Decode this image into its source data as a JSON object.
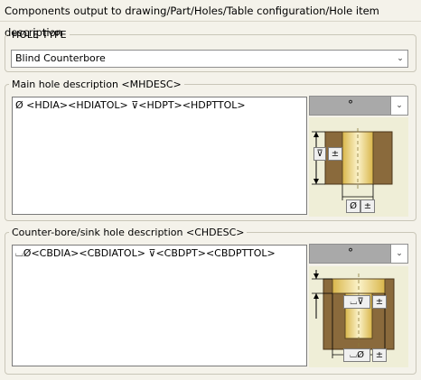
{
  "title": "Components output to drawing/Part/Holes/Table configuration/Hole item description",
  "hole_type": {
    "legend": "HOLE TYPE",
    "selected": "Blind Counterbore"
  },
  "main_hole": {
    "legend": "Main hole description <MHDESC>",
    "text": "Ø <HDIA><HDIATOL> ⊽<HDPT><HDPTTOL>",
    "symbol_value": "°",
    "diagram": {
      "depth_symbol": "⊽",
      "depth_tol": "±",
      "dia_symbol": "Ø",
      "dia_tol": "±"
    }
  },
  "counter_hole": {
    "legend": "Counter-bore/sink hole description <CHDESC>",
    "text": "⌴Ø<CBDIA><CBDIATOL> ⊽<CBDPT><CBDPTTOL>",
    "symbol_value": "°",
    "diagram": {
      "depth_symbol": "⌴⊽",
      "depth_tol": "±",
      "dia_symbol": "⌴Ø",
      "dia_tol": "±"
    }
  },
  "icons": {
    "dropdown": "chevron-down-icon"
  },
  "colors": {
    "wood": "#8a6a3c",
    "wood_dark": "#6b4e26",
    "bore": "#f5e9b0",
    "bore_gold": "#e3c25a",
    "diagram_bg": "#efeed7"
  }
}
